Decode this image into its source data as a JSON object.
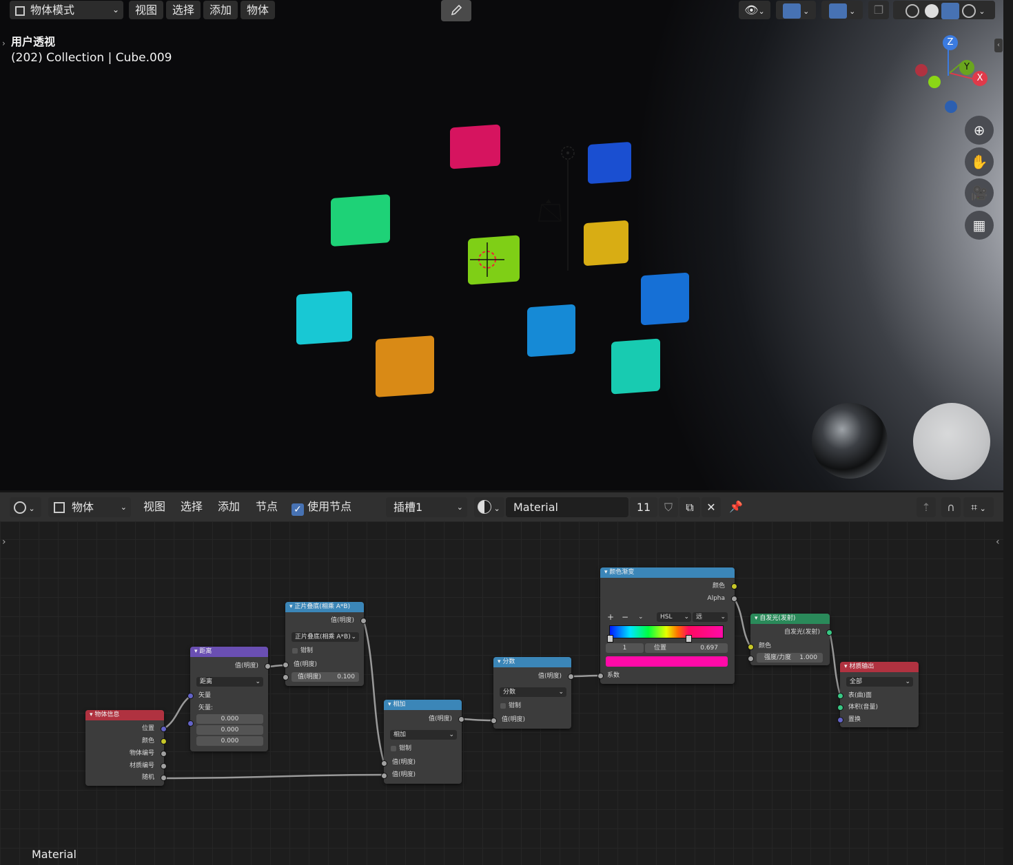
{
  "viewport": {
    "mode_label": "物体模式",
    "menus": [
      "视图",
      "选择",
      "添加",
      "物体"
    ],
    "view_name": "用户透视",
    "collection_info": "(202) Collection | Cube.009",
    "gizmo": {
      "z": "Z",
      "y": "Y",
      "x": "X"
    }
  },
  "node_editor": {
    "object_label": "物体",
    "menus": [
      "视图",
      "选择",
      "添加",
      "节点"
    ],
    "use_nodes_label": "使用节点",
    "slot_label": "插槽1",
    "material_name": "Material",
    "user_count": "11",
    "footer_material": "Material"
  },
  "nodes": {
    "object_info": {
      "title": "物体信息",
      "outputs": [
        "位置",
        "颜色",
        "物体编号",
        "材质编号",
        "随机"
      ]
    },
    "distance": {
      "title": "距离",
      "output": "值(明度)",
      "op": "距离",
      "input1": "矢量",
      "input2": "矢量:",
      "values": [
        "0.000",
        "0.000",
        "0.000"
      ]
    },
    "multiply": {
      "title": "正片叠底(相乘 A*B)",
      "output": "值(明度)",
      "op": "正片叠底(相乘 A*B)",
      "clamp": "钳制",
      "input1": "值(明度)",
      "input2_label": "值(明度)",
      "input2_value": "0.100"
    },
    "add": {
      "title": "相加",
      "output": "值(明度)",
      "op": "相加",
      "clamp": "钳制",
      "input1": "值(明度)",
      "input2": "值(明度)"
    },
    "fraction": {
      "title": "分数",
      "output": "值(明度)",
      "op": "分数",
      "clamp": "钳制",
      "input1": "值(明度)"
    },
    "color_ramp": {
      "title": "颜色渐变",
      "out_color": "颜色",
      "out_alpha": "Alpha",
      "mode": "HSL",
      "interp": "远",
      "stop_index": "1",
      "pos_label": "位置",
      "pos_value": "0.697",
      "input": "系数",
      "plus": "+",
      "minus": "−"
    },
    "emission": {
      "title": "自发光(发射)",
      "output": "自发光(发射)",
      "color": "颜色",
      "strength_label": "强度/力度",
      "strength_value": "1.000"
    },
    "output": {
      "title": "材质输出",
      "target": "全部",
      "surface": "表(曲)面",
      "volume": "体积(音量)",
      "displacement": "置换"
    }
  },
  "colors": {
    "accent": "#4772b3",
    "node_math": "#3b86b8",
    "node_vector": "#6a4fb3",
    "node_input": "#b03240",
    "node_shader": "#2a8a5a",
    "node_output": "#b03240"
  }
}
